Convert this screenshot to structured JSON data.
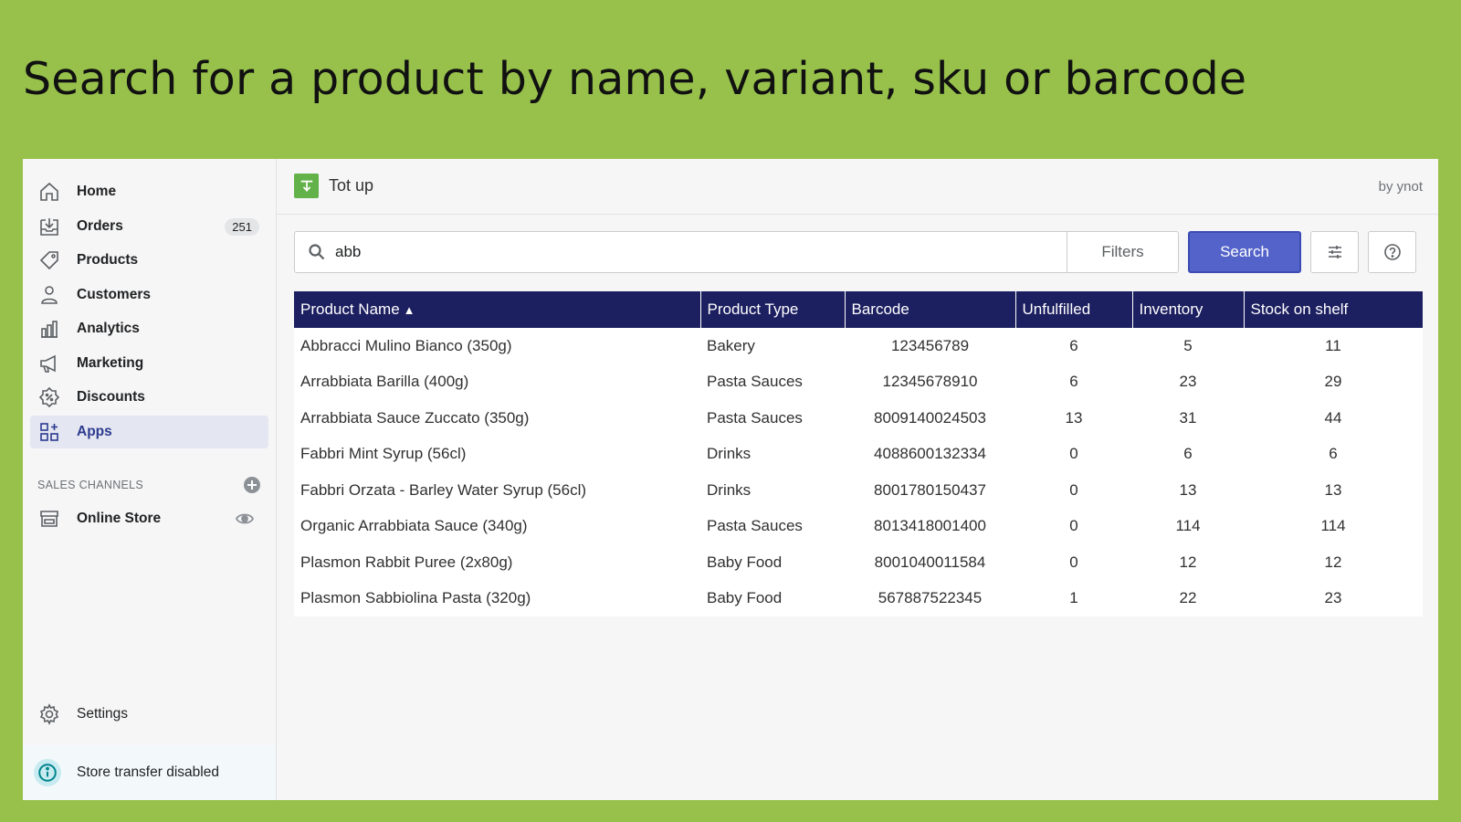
{
  "headline": "Search for a product by name, variant, sku or barcode",
  "sidebar": {
    "items": [
      {
        "label": "Home",
        "icon": "home-icon"
      },
      {
        "label": "Orders",
        "icon": "orders-icon",
        "badge": "251"
      },
      {
        "label": "Products",
        "icon": "tag-icon"
      },
      {
        "label": "Customers",
        "icon": "person-icon"
      },
      {
        "label": "Analytics",
        "icon": "bar-chart-icon"
      },
      {
        "label": "Marketing",
        "icon": "megaphone-icon"
      },
      {
        "label": "Discounts",
        "icon": "discount-icon"
      },
      {
        "label": "Apps",
        "icon": "apps-icon",
        "active": true
      }
    ],
    "sales_channels_title": "SALES CHANNELS",
    "online_store_label": "Online Store",
    "settings_label": "Settings",
    "store_transfer_label": "Store transfer disabled"
  },
  "app": {
    "name": "Tot up",
    "byline": "by ynot"
  },
  "search": {
    "value": "abb",
    "filters_label": "Filters",
    "search_label": "Search"
  },
  "table": {
    "columns": [
      "Product Name",
      "Product Type",
      "Barcode",
      "Unfulfilled",
      "Inventory",
      "Stock on shelf"
    ],
    "sort_indicator": "▲",
    "rows": [
      [
        "Abbracci Mulino Bianco (350g)",
        "Bakery",
        "123456789",
        "6",
        "5",
        "11"
      ],
      [
        "Arrabbiata Barilla (400g)",
        "Pasta Sauces",
        "12345678910",
        "6",
        "23",
        "29"
      ],
      [
        "Arrabbiata Sauce Zuccato (350g)",
        "Pasta Sauces",
        "8009140024503",
        "13",
        "31",
        "44"
      ],
      [
        "Fabbri Mint Syrup (56cl)",
        "Drinks",
        "4088600132334",
        "0",
        "6",
        "6"
      ],
      [
        "Fabbri Orzata - Barley Water Syrup (56cl)",
        "Drinks",
        "8001780150437",
        "0",
        "13",
        "13"
      ],
      [
        "Organic Arrabbiata Sauce (340g)",
        "Pasta Sauces",
        "8013418001400",
        "0",
        "114",
        "114"
      ],
      [
        "Plasmon Rabbit Puree (2x80g)",
        "Baby Food",
        "8001040011584",
        "0",
        "12",
        "12"
      ],
      [
        "Plasmon Sabbiolina Pasta (320g)",
        "Baby Food",
        "567887522345",
        "1",
        "22",
        "23"
      ]
    ]
  },
  "colors": {
    "background": "#97c14b",
    "table_header": "#1c1f60",
    "primary_button": "#5363c9",
    "app_logo": "#62b149"
  }
}
